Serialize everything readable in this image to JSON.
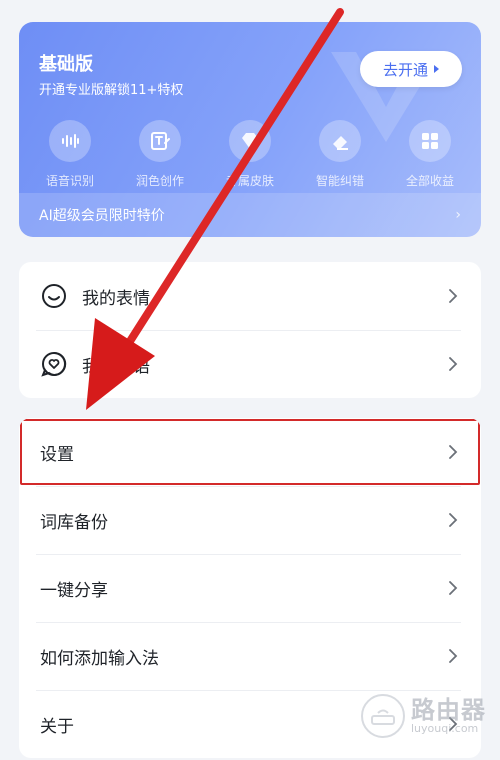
{
  "vip": {
    "title": "基础版",
    "subtitle": "开通专业版解锁11+特权",
    "open_button": "去开通",
    "perks": [
      {
        "icon": "voice-wave-icon",
        "label": "语音识别"
      },
      {
        "icon": "text-edit-icon",
        "label": "润色创作"
      },
      {
        "icon": "diamond-skin-icon",
        "label": "专属皮肤"
      },
      {
        "icon": "eraser-icon",
        "label": "智能纠错"
      },
      {
        "icon": "grid-apps-icon",
        "label": "全部收益"
      }
    ],
    "promo": "AI超级会员限时特价"
  },
  "menu_group_1": [
    {
      "icon": "smiley-icon",
      "label": "我的表情"
    },
    {
      "icon": "heart-bubble-icon",
      "label": "我的妙语"
    }
  ],
  "menu_group_2": [
    {
      "label": "设置"
    },
    {
      "label": "词库备份"
    },
    {
      "label": "一键分享"
    },
    {
      "label": "如何添加输入法"
    },
    {
      "label": "关于"
    }
  ],
  "watermark": {
    "main": "路由器",
    "sub": "luyouqi.com"
  },
  "colors": {
    "card_gradient_start": "#6e8ef5",
    "card_gradient_end": "#a8bdfb",
    "highlight_border": "#d32a2a",
    "arrow": "#e01b1b"
  }
}
